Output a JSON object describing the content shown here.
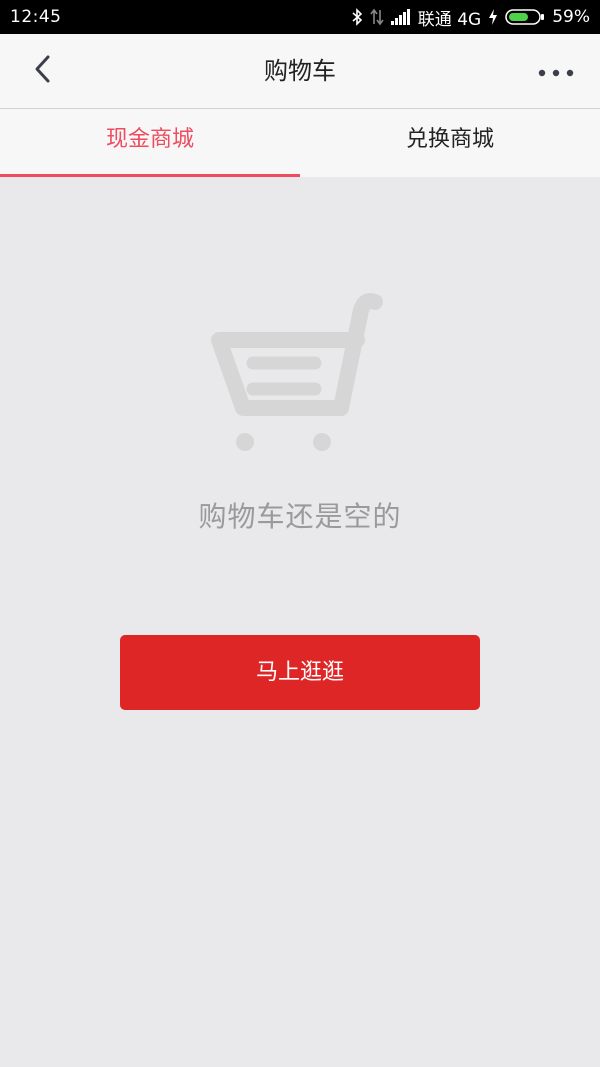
{
  "status_bar": {
    "time": "12:45",
    "carrier": "联通 4G",
    "battery": "59%",
    "icons": [
      "bluetooth-icon",
      "data-arrows-icon",
      "signal-icon",
      "charging-icon",
      "battery-icon"
    ]
  },
  "nav": {
    "title": "购物车",
    "back_icon": "chevron-left-icon",
    "more_icon": "more-dots-icon"
  },
  "tabs": [
    {
      "label": "现金商城",
      "active": true
    },
    {
      "label": "兑换商城",
      "active": false
    }
  ],
  "empty_state": {
    "icon": "shopping-cart-icon",
    "message": "购物车还是空的",
    "button_label": "马上逛逛"
  },
  "colors": {
    "accent": "#ee4c5f",
    "button": "#df2627",
    "background": "#e9e9ec"
  }
}
